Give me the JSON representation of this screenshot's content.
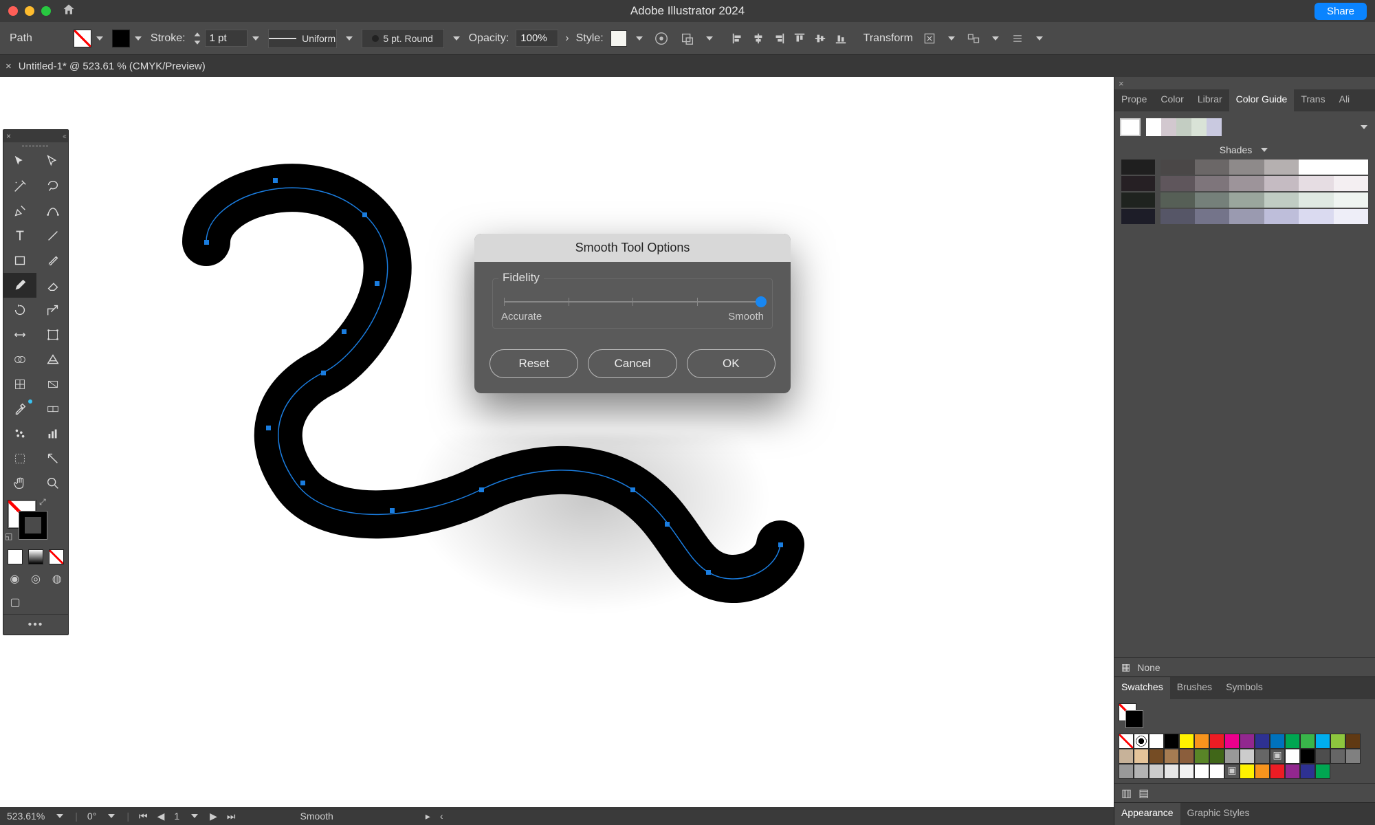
{
  "app": {
    "title": "Adobe Illustrator 2024",
    "share_label": "Share"
  },
  "controlbar": {
    "selection_label": "Path",
    "stroke_label": "Stroke:",
    "stroke_value": "1 pt",
    "stroke_style_label": "Uniform",
    "brush_label": "5 pt. Round",
    "opacity_label": "Opacity:",
    "opacity_value": "100%",
    "style_label": "Style:",
    "transform_label": "Transform"
  },
  "tab": {
    "label": "Untitled-1* @ 523.61 % (CMYK/Preview)"
  },
  "dialog": {
    "title": "Smooth Tool Options",
    "fidelity_label": "Fidelity",
    "accurate_label": "Accurate",
    "smooth_label": "Smooth",
    "slider_value": 100,
    "reset_label": "Reset",
    "cancel_label": "Cancel",
    "ok_label": "OK"
  },
  "right_panels": {
    "top_tabs": [
      "Prope",
      "Color",
      "Librar",
      "Color Guide",
      "Trans",
      "Ali"
    ],
    "top_active_tab": "Color Guide",
    "color_guide": {
      "shade_label": "Shades",
      "base_strip": [
        "#ffffff",
        "#d2c8cf",
        "#c3cdc2",
        "#d9e3d7",
        "#c9c9e0"
      ],
      "rows": [
        {
          "lead": "#1f1f1f",
          "cells": [
            "#4a4747",
            "#6b6767",
            "#8e8a8a",
            "#b5b0b0",
            "#ffffff",
            "#ffffff"
          ]
        },
        {
          "lead": "#262024",
          "cells": [
            "#5f565c",
            "#7e757b",
            "#9d949a",
            "#c5bbc2",
            "#e6dde3",
            "#f4eff2"
          ]
        },
        {
          "lead": "#1f231f",
          "cells": [
            "#565f56",
            "#75807a",
            "#9aa69d",
            "#c0ccc3",
            "#dfe9e2",
            "#eff5f1"
          ]
        },
        {
          "lead": "#1d1d28",
          "cells": [
            "#565667",
            "#74748a",
            "#9a9ab0",
            "#bebeda",
            "#dadaf0",
            "#eeeef8"
          ]
        }
      ],
      "none_label": "None"
    },
    "mid_tabs": [
      "Swatches",
      "Brushes",
      "Symbols"
    ],
    "mid_active_tab": "Swatches",
    "swatches": {
      "rows": [
        [
          "none",
          "reg",
          "#ffffff",
          "#000000",
          "#fff200",
          "#f7941d",
          "#ed1c24",
          "#ec008c",
          "#92278f",
          "#2e3192",
          "#0072bc",
          "#00a651",
          "#39b54a"
        ],
        [
          "#00aeef",
          "#8dc63e",
          "#603913",
          "#c7b299",
          "#e5c49a",
          "#754c24",
          "#a67c52",
          "#8b5e3c",
          "#598527",
          "#406618",
          "#999999",
          "#cccccc",
          "#666666"
        ],
        [
          "folder",
          "#ffffff",
          "#000000",
          "#4d4d4d",
          "#666666",
          "#808080",
          "#999999",
          "#b3b3b3",
          "#cccccc",
          "#e6e6e6",
          "#f2f2f2",
          "#ffffff",
          "#ffffff"
        ],
        [
          "folder",
          "#fff200",
          "#f7941d",
          "#ed1c24",
          "#92278f",
          "#2e3192",
          "#00a651",
          "",
          "",
          "",
          "",
          "",
          ""
        ]
      ]
    },
    "bottom_tabs": [
      "Appearance",
      "Graphic Styles"
    ],
    "bottom_active_tab": "Appearance"
  },
  "statusbar": {
    "zoom": "523.61%",
    "rotate": "0°",
    "page": "1",
    "tool": "Smooth"
  },
  "tools": [
    "selection",
    "direct-selection",
    "magic-wand",
    "lasso",
    "pen",
    "curvature",
    "type",
    "line",
    "rectangle",
    "paintbrush",
    "pencil",
    "eraser",
    "rotate",
    "scale",
    "width",
    "free-transform",
    "shape-builder",
    "perspective",
    "mesh",
    "gradient",
    "eyedropper",
    "blend",
    "symbol-sprayer",
    "column-graph",
    "artboard",
    "slice",
    "hand",
    "zoom"
  ]
}
